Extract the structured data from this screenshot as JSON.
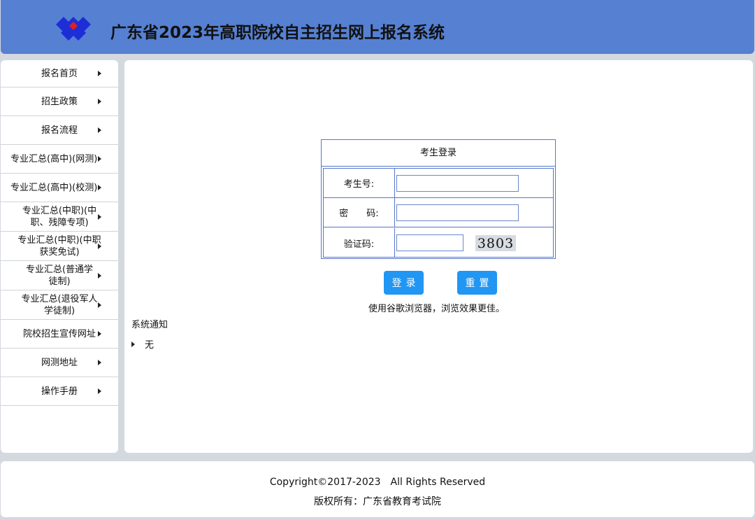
{
  "header": {
    "title": "广东省2023年高职院校自主招生网上报名系统",
    "colors": {
      "bar": "#5680d2",
      "logo_blue": "#1d2ed6",
      "logo_red": "#e31f1f"
    }
  },
  "sidebar": {
    "items": [
      {
        "label": "报名首页"
      },
      {
        "label": "招生政策"
      },
      {
        "label": "报名流程"
      },
      {
        "label": "专业汇总(高中)(网测)"
      },
      {
        "label": "专业汇总(高中)(校测)"
      },
      {
        "label": "专业汇总(中职)(中职、残障专项)"
      },
      {
        "label": "专业汇总(中职)(中职获奖免试)"
      },
      {
        "label": "专业汇总(普通学徒制)"
      },
      {
        "label": "专业汇总(退役军人学徒制)"
      },
      {
        "label": "院校招生宣传网址"
      },
      {
        "label": "网测地址"
      },
      {
        "label": "操作手册"
      }
    ]
  },
  "login": {
    "title": "考生登录",
    "exam_no_label": "考生号:",
    "exam_no_value": "",
    "password_label": "密　　码:",
    "password_value": "",
    "captcha_label": "验证码:",
    "captcha_value": "",
    "captcha_image_text": "3803",
    "login_button": "登录",
    "reset_button": "重置",
    "hint": "使用谷歌浏览器，浏览效果更佳。"
  },
  "notice": {
    "title": "系统通知",
    "items": [
      "无"
    ]
  },
  "footer": {
    "copyright": "Copyright©2017-2023　All Rights Reserved",
    "owner": "版权所有：广东省教育考试院"
  },
  "colors": {
    "accent": "#2196f3",
    "border": "#5576c9",
    "page_bg": "#d4d8df"
  }
}
